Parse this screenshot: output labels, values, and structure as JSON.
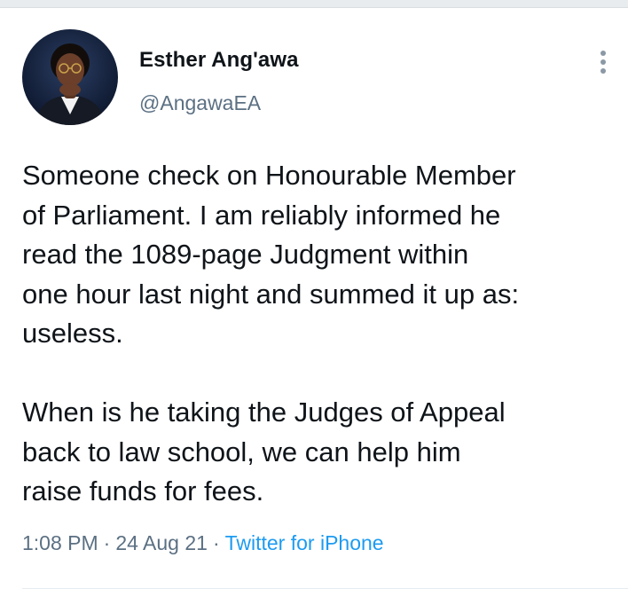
{
  "author": {
    "name": "Esther Ang'awa",
    "handle": "@AngawaEA"
  },
  "tweet": {
    "text": "Someone check on Honourable Member\nof Parliament. I am reliably informed he\nread the 1089-page Judgment within\none hour last night and summed it up as:\nuseless.\n\nWhen is he taking the Judges of Appeal\nback to law school, we can help him\nraise funds for fees.",
    "time": "1:08 PM",
    "date": "24 Aug 21",
    "source": "Twitter for iPhone",
    "separator": "·"
  },
  "icons": {
    "more": "more-vertical-icon",
    "avatar": "profile-avatar"
  },
  "colors": {
    "text": "#0f1419",
    "secondary": "#5b7083",
    "link": "#1d9bf0",
    "divider": "#e6ecf0"
  }
}
